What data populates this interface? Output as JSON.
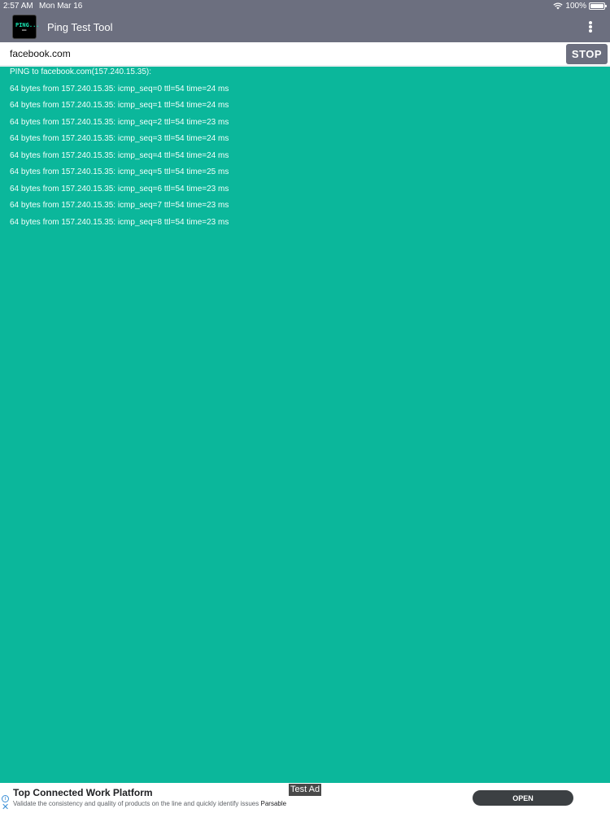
{
  "status_bar": {
    "time": "2:57 AM",
    "date": "Mon Mar 16",
    "battery_percent": "100%",
    "icons": [
      "wifi-icon",
      "battery-icon"
    ]
  },
  "app_bar": {
    "icon_text": "PING...",
    "title": "Ping Test Tool",
    "menu_icon": "more-vertical-icon"
  },
  "host": {
    "value": "facebook.com",
    "stop_label": "STOP"
  },
  "output": {
    "header": "PING to facebook.com(157.240.15.35):",
    "lines": [
      "64 bytes from 157.240.15.35: icmp_seq=0 ttl=54 time=24 ms",
      "64 bytes from 157.240.15.35: icmp_seq=1 ttl=54 time=24 ms",
      "64 bytes from 157.240.15.35: icmp_seq=2 ttl=54 time=23 ms",
      "64 bytes from 157.240.15.35: icmp_seq=3 ttl=54 time=24 ms",
      "64 bytes from 157.240.15.35: icmp_seq=4 ttl=54 time=24 ms",
      "64 bytes from 157.240.15.35: icmp_seq=5 ttl=54 time=25 ms",
      "64 bytes from 157.240.15.35: icmp_seq=6 ttl=54 time=23 ms",
      "64 bytes from 157.240.15.35: icmp_seq=7 ttl=54 time=23 ms",
      "64 bytes from 157.240.15.35: icmp_seq=8 ttl=54 time=23 ms"
    ]
  },
  "ad": {
    "badge": "Test Ad",
    "title": "Top Connected Work Platform",
    "description": "Validate the consistency and quality of products on the line and quickly identify issues",
    "brand": "Parsable",
    "cta": "OPEN",
    "icons": [
      "info-icon",
      "close-icon"
    ]
  },
  "colors": {
    "background": "#0bb79b",
    "toolbar": "#6c6f7f",
    "output_text": "#f3fffb"
  }
}
